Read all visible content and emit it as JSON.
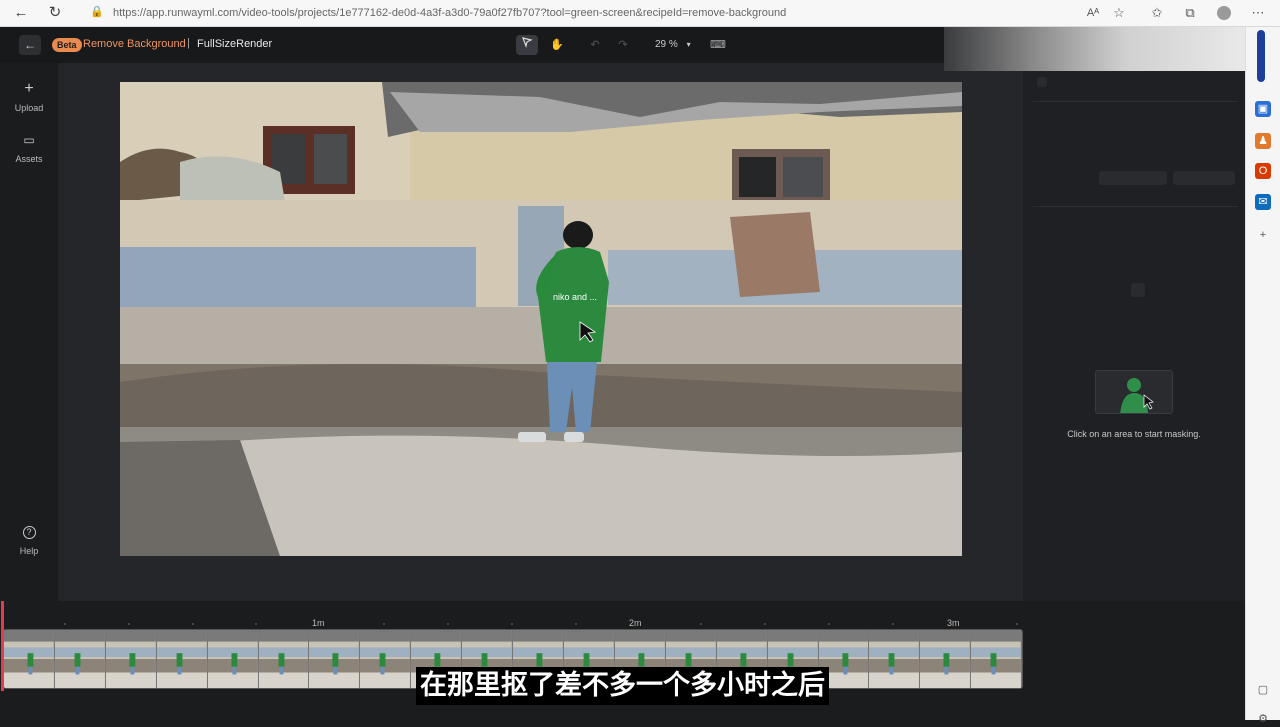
{
  "browser": {
    "url": "https://app.runwayml.com/video-tools/projects/1e777162-de0d-4a3f-a3d0-79a0f27fb707?tool=green-screen&recipeId=remove-background",
    "read_aloud": "Aᴬ"
  },
  "app": {
    "beta_label": "Beta",
    "tool_title": "Remove Background",
    "separator": "|",
    "file_title": "FullSizeRender",
    "zoom": "29 %",
    "zoom_caret": "▾"
  },
  "left_rail": {
    "upload_label": "Upload",
    "assets_label": "Assets",
    "help_label": "Help"
  },
  "right_panel": {
    "mask_hint": "Click on an area to start masking."
  },
  "timeline": {
    "ticks": [
      "1m",
      "2m",
      "3m"
    ]
  },
  "video": {
    "hoodie_text": "niko and ..."
  },
  "subtitle": "在那里抠了差不多一个多小时之后",
  "colors": {
    "accent": "#e98a4f",
    "playhead": "#e33c4d",
    "mask_green": "#2f8f4a"
  }
}
